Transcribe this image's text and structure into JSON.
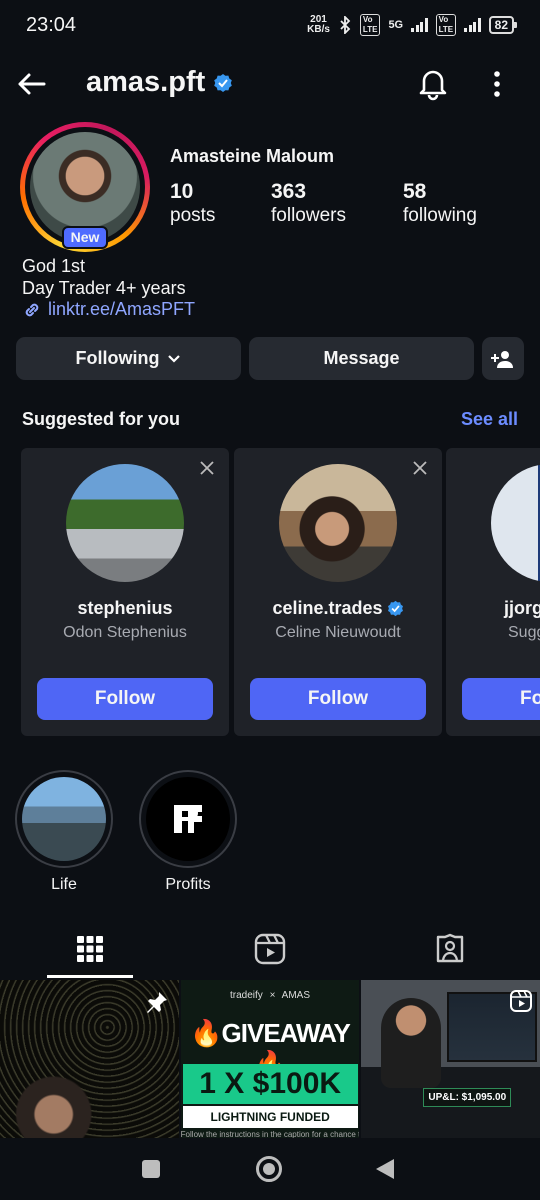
{
  "status": {
    "time": "23:04",
    "speed_value": "201",
    "speed_unit": "KB/s",
    "network": "5G",
    "volte": "Vo LTE",
    "battery": "82"
  },
  "header": {
    "username": "amas.pft"
  },
  "profile": {
    "full_name": "Amasteine Maloum",
    "badge": "New",
    "stats": [
      {
        "number": "10",
        "label": "posts"
      },
      {
        "number": "363",
        "label": "followers"
      },
      {
        "number": "58",
        "label": "following"
      }
    ],
    "bio_line1": "God 1st",
    "bio_line2": "Day Trader 4+ years",
    "link": "linktr.ee/AmasPFT"
  },
  "actions": {
    "following": "Following",
    "message": "Message"
  },
  "suggested": {
    "title": "Suggested for you",
    "see_all": "See all",
    "cards": [
      {
        "username": "stephenius",
        "name": "Odon Stephenius",
        "follow": "Follow",
        "verified": false
      },
      {
        "username": "celine.trades",
        "name": "Celine Nieuwoudt",
        "follow": "Follow",
        "verified": true
      },
      {
        "username": "jjorg",
        "name": "Sugg",
        "follow": "Fo",
        "verified": false
      }
    ]
  },
  "highlights": [
    {
      "label": "Life"
    },
    {
      "label": "Profits"
    }
  ],
  "posts": {
    "post2": {
      "brand_left": "tradeify",
      "brand_x": "×",
      "brand_right": "AMAS",
      "headline": "GIVEAWAY",
      "amount": "1 X $100K",
      "sub": "LIGHTNING FUNDED",
      "footer": "Follow the instructions in the caption for a chance to win"
    },
    "post3": {
      "pnl": "UP&L: $1,095.00"
    }
  },
  "colors": {
    "accent": "#4f66f5",
    "link": "#8fa6ff",
    "background": "#0c0f14",
    "card": "#1f2228"
  }
}
